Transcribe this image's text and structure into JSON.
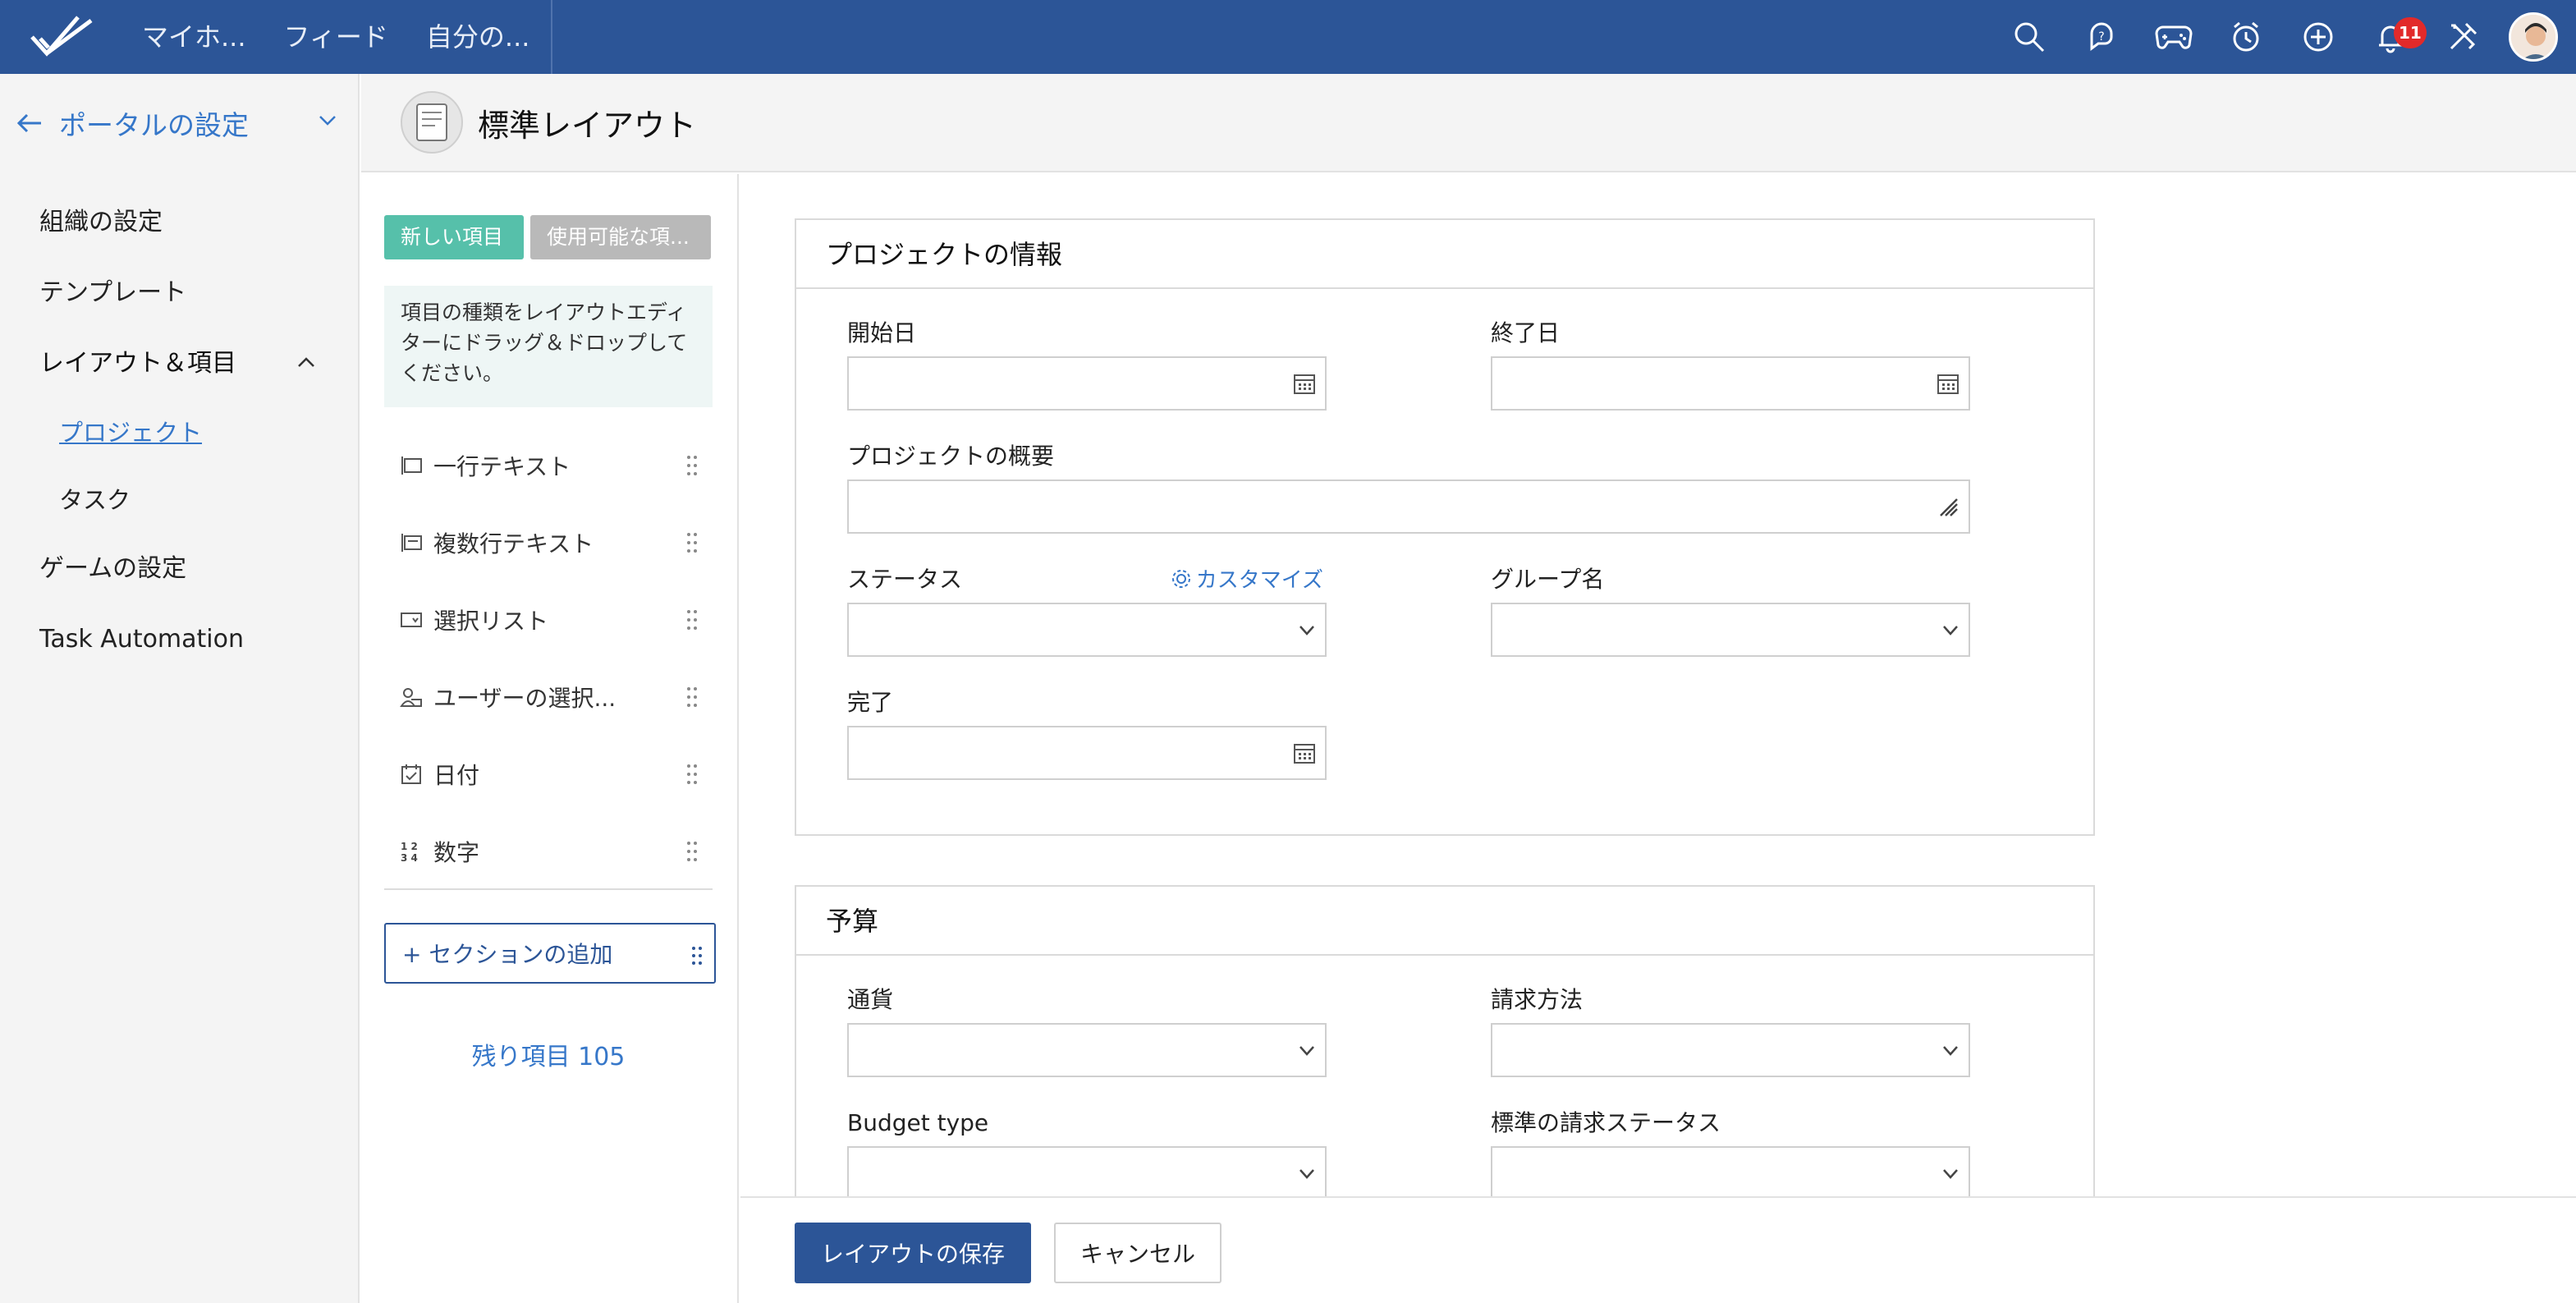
{
  "topbar": {
    "nav": [
      "マイホ...",
      "フィード",
      "自分の..."
    ],
    "icons": [
      "search-icon",
      "help-chat-icon",
      "game-controller-icon",
      "timer-icon",
      "add-icon",
      "bell-icon",
      "tools-icon"
    ],
    "notification_count": "11",
    "brand_color": "#2c5597"
  },
  "sidebar": {
    "header": "ポータルの設定",
    "items": [
      {
        "label": "組織の設定"
      },
      {
        "label": "テンプレート"
      },
      {
        "label": "レイアウト＆項目"
      },
      {
        "label": "ゲームの設定"
      },
      {
        "label": "Task Automation"
      }
    ],
    "subitems": [
      {
        "label": "プロジェクト",
        "active": true
      },
      {
        "label": "タスク",
        "active": false
      }
    ]
  },
  "page": {
    "title": "標準レイアウト"
  },
  "palette": {
    "tab_new": "新しい項目",
    "tab_available": "使用可能な項...",
    "hint": "項目の種類をレイアウトエディターにドラッグ＆ドロップしてください。",
    "fields": [
      {
        "label": "一行テキスト",
        "icon": "single-line-icon"
      },
      {
        "label": "複数行テキスト",
        "icon": "multi-line-icon"
      },
      {
        "label": "選択リスト",
        "icon": "picklist-icon"
      },
      {
        "label": "ユーザーの選択...",
        "icon": "user-picker-icon"
      },
      {
        "label": "日付",
        "icon": "date-icon"
      },
      {
        "label": "数字",
        "icon": "number-icon"
      }
    ],
    "add_section": "+ セクションの追加",
    "remaining": "残り項目 105"
  },
  "sections": [
    {
      "title": "プロジェクトの情報",
      "fields": {
        "start_date": "開始日",
        "end_date": "終了日",
        "overview": "プロジェクトの概要",
        "status": "ステータス",
        "customize": "カスタマイズ",
        "group": "グループ名",
        "completed": "完了"
      }
    },
    {
      "title": "予算",
      "fields": {
        "currency": "通貨",
        "billing_method": "請求方法",
        "budget_type": "Budget type",
        "default_billing_status": "標準の請求ステータス"
      }
    }
  ],
  "footer": {
    "save": "レイアウトの保存",
    "cancel": "キャンセル"
  }
}
